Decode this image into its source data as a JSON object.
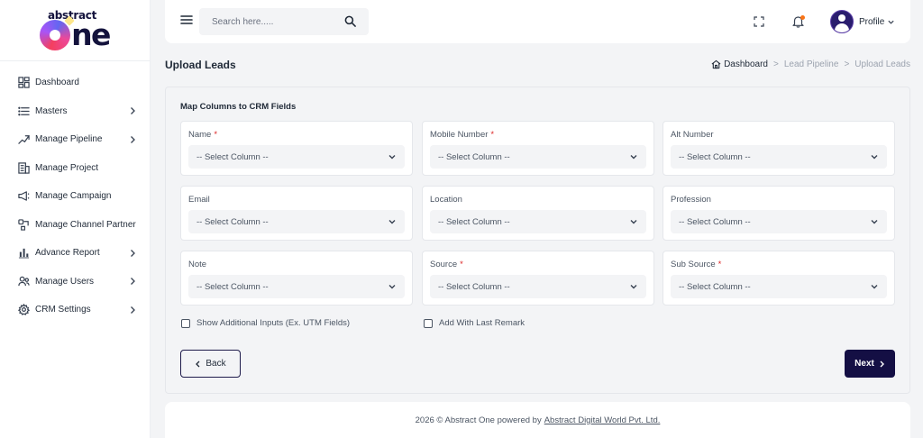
{
  "brand": {
    "line1": "abstract",
    "line2": "ne"
  },
  "sidebar": {
    "items": [
      {
        "label": "Dashboard",
        "icon": "dashboard-icon",
        "has_children": false
      },
      {
        "label": "Masters",
        "icon": "list-icon",
        "has_children": true
      },
      {
        "label": "Manage Pipeline",
        "icon": "pipeline-icon",
        "has_children": true
      },
      {
        "label": "Manage Project",
        "icon": "building-icon",
        "has_children": false
      },
      {
        "label": "Manage Campaign",
        "icon": "megaphone-icon",
        "has_children": false
      },
      {
        "label": "Manage Channel Partner",
        "icon": "handshake-icon",
        "has_children": false
      },
      {
        "label": "Advance Report",
        "icon": "bar-chart-icon",
        "has_children": true
      },
      {
        "label": "Manage Users",
        "icon": "users-icon",
        "has_children": true
      },
      {
        "label": "CRM Settings",
        "icon": "gear-icon",
        "has_children": true
      }
    ]
  },
  "topbar": {
    "search_placeholder": "Search here.....",
    "profile_label": "Profile"
  },
  "page": {
    "title": "Upload Leads",
    "breadcrumb": {
      "home": "Dashboard",
      "parent": "Lead Pipeline",
      "current": "Upload Leads",
      "separator": ">"
    }
  },
  "card": {
    "title": "Map Columns to CRM Fields",
    "select_placeholder": "-- Select Column --",
    "fields": [
      {
        "label": "Name",
        "required": true
      },
      {
        "label": "Mobile Number",
        "required": true
      },
      {
        "label": "Alt Number",
        "required": false
      },
      {
        "label": "Email",
        "required": false
      },
      {
        "label": "Location",
        "required": false
      },
      {
        "label": "Profession",
        "required": false
      },
      {
        "label": "Note",
        "required": false
      },
      {
        "label": "Source",
        "required": true
      },
      {
        "label": "Sub Source",
        "required": true
      }
    ],
    "required_mark": "*",
    "checkboxes": [
      {
        "label": "Show Additional Inputs (Ex. UTM Fields)",
        "checked": false
      },
      {
        "label": "Add With Last Remark",
        "checked": false
      }
    ],
    "back_label": "Back",
    "next_label": "Next"
  },
  "footer": {
    "text": "2026 © Abstract One powered by",
    "link": "Abstract Digital World Pvt. Ltd."
  },
  "colors": {
    "accent": "#140f44",
    "required": "#dc2626",
    "notification": "#f97316",
    "background": "#f3f4f6"
  }
}
